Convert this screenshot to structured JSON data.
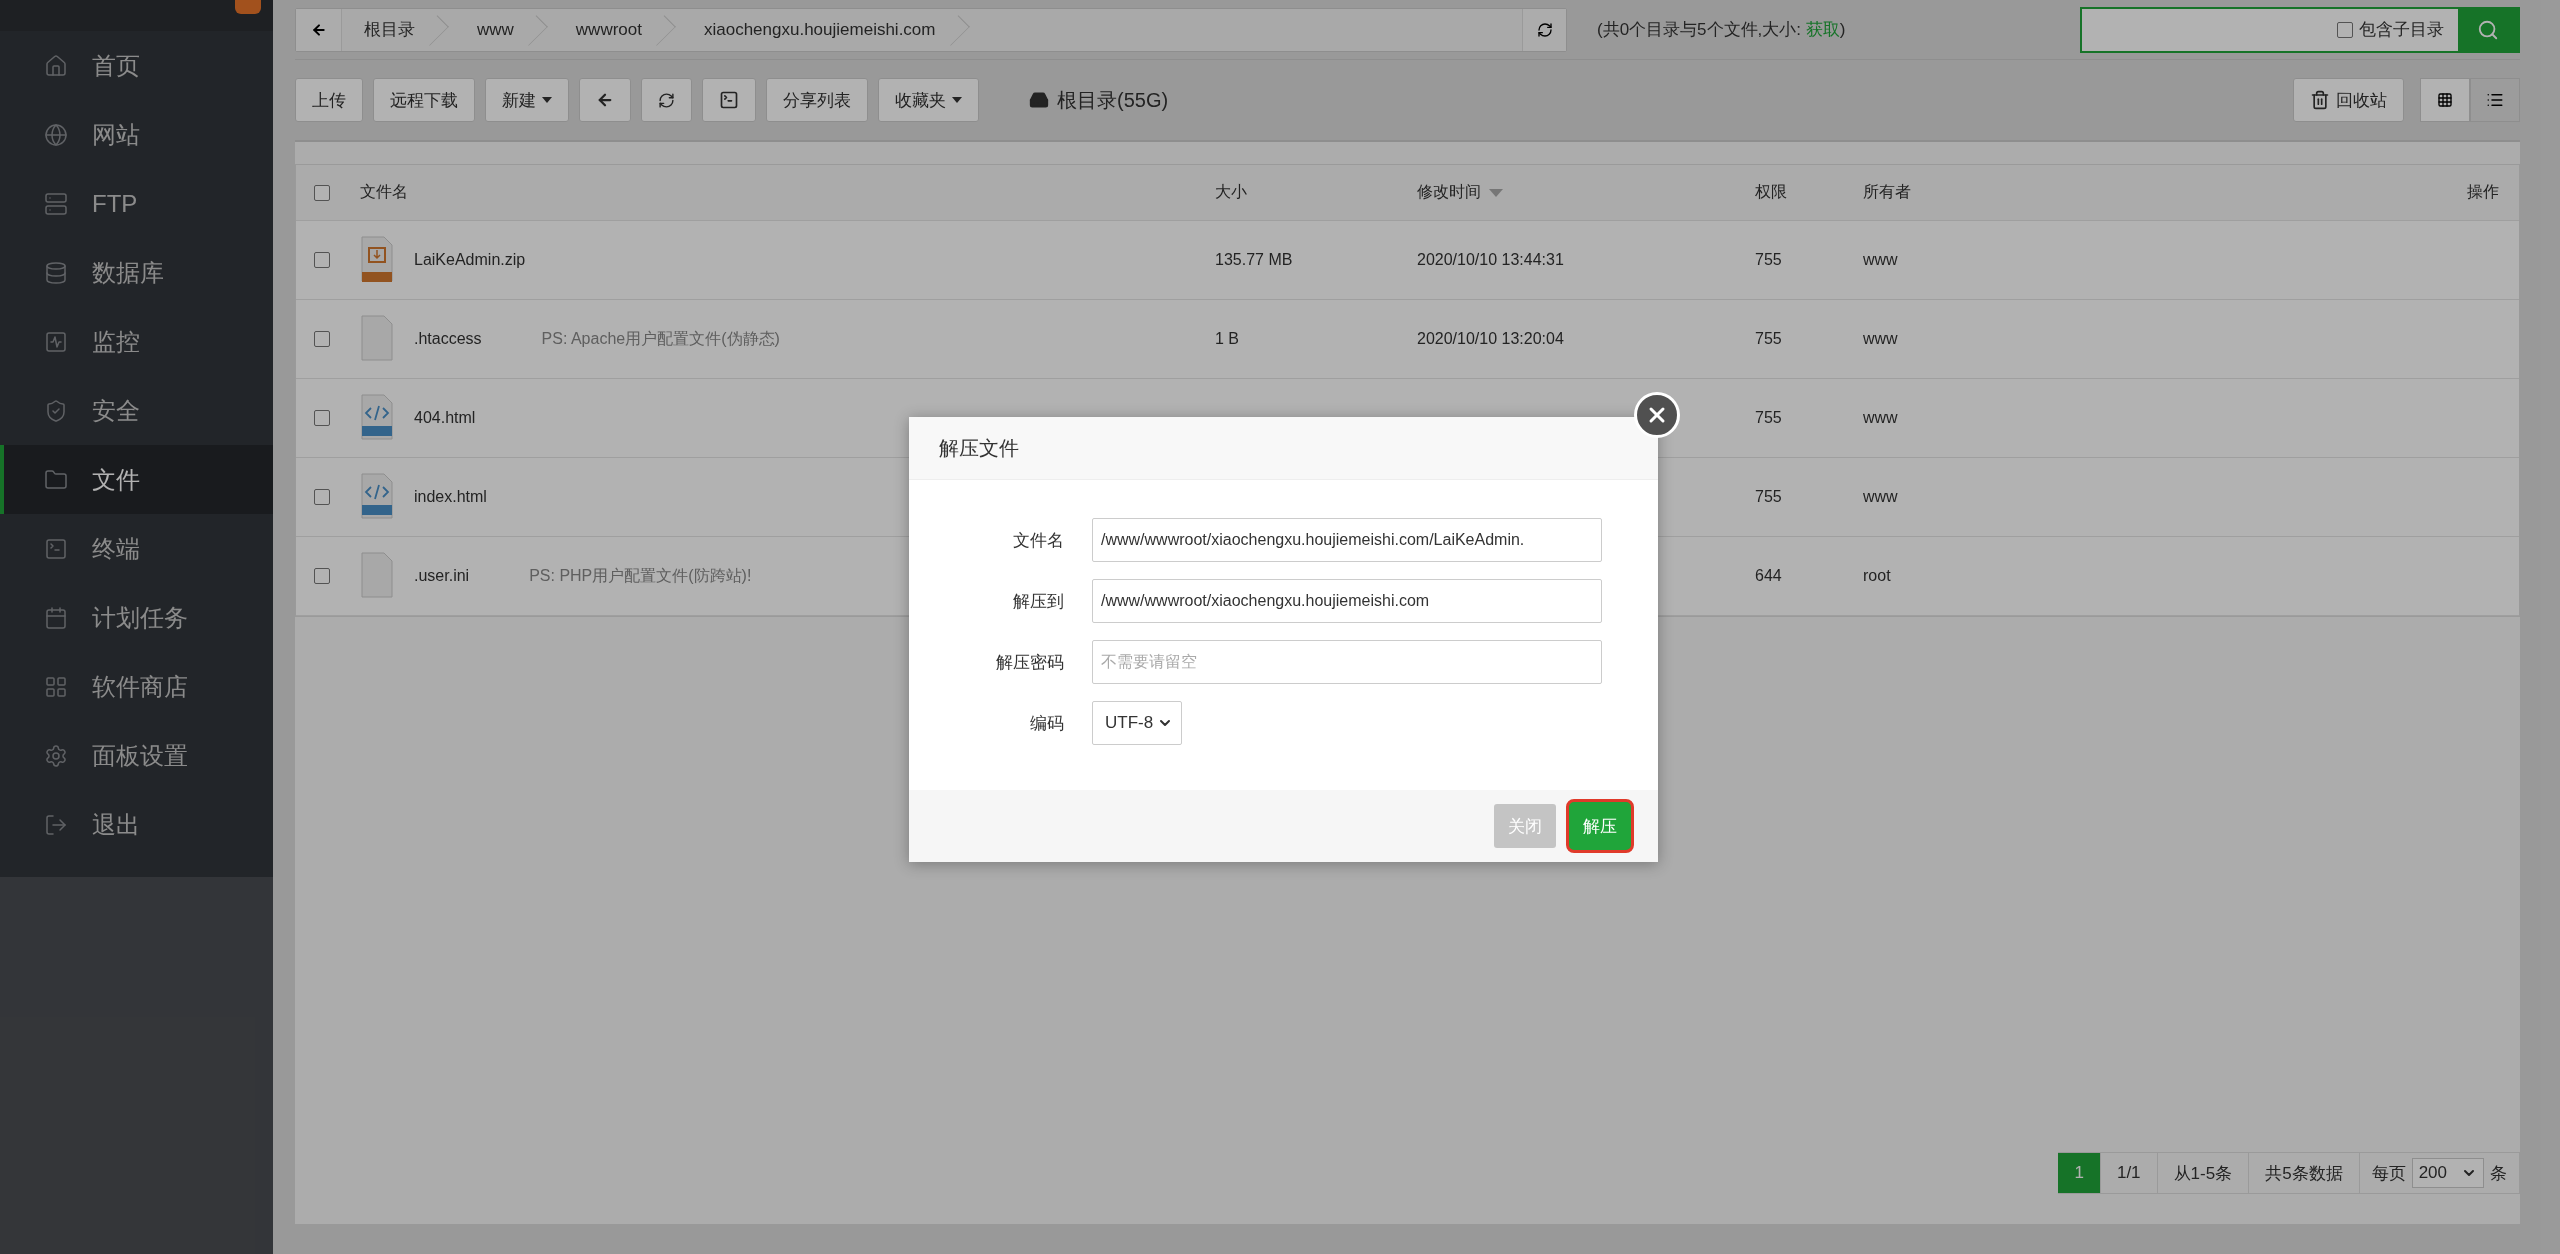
{
  "sidebar": {
    "items": [
      {
        "label": "首页",
        "selected": false
      },
      {
        "label": "网站",
        "selected": false
      },
      {
        "label": "FTP",
        "selected": false
      },
      {
        "label": "数据库",
        "selected": false
      },
      {
        "label": "监控",
        "selected": false
      },
      {
        "label": "安全",
        "selected": false
      },
      {
        "label": "文件",
        "selected": true
      },
      {
        "label": "终端",
        "selected": false
      },
      {
        "label": "计划任务",
        "selected": false
      },
      {
        "label": "软件商店",
        "selected": false
      },
      {
        "label": "面板设置",
        "selected": false
      },
      {
        "label": "退出",
        "selected": false
      }
    ]
  },
  "breadcrumb": {
    "segments": [
      "根目录",
      "www",
      "wwwroot",
      "xiaochengxu.houjiemeishi.com"
    ]
  },
  "summary": {
    "prefix": "(共0个目录与5个文件,大小: ",
    "link": "获取",
    "suffix": ")"
  },
  "search": {
    "checkbox_label": "包含子目录",
    "include_subdirs": false
  },
  "toolbar": {
    "buttons": [
      {
        "kind": "text",
        "label": "上传"
      },
      {
        "kind": "text",
        "label": "远程下载"
      },
      {
        "kind": "dropdown",
        "label": "新建"
      },
      {
        "kind": "back"
      },
      {
        "kind": "refresh"
      },
      {
        "kind": "terminal"
      },
      {
        "kind": "text",
        "label": "分享列表"
      },
      {
        "kind": "dropdown",
        "label": "收藏夹"
      }
    ],
    "disk": "根目录(55G)",
    "recycle": "回收站",
    "views": [
      {
        "selected": false
      },
      {
        "selected": true
      }
    ]
  },
  "table": {
    "all_checked": false,
    "columns": [
      {
        "label": "文件名",
        "sorted": false
      },
      {
        "label": "大小",
        "sorted": false
      },
      {
        "label": "修改时间",
        "sorted": true
      },
      {
        "label": "权限",
        "sorted": false
      },
      {
        "label": "所有者",
        "sorted": false
      },
      {
        "label": "操作",
        "sorted": false
      }
    ],
    "rows": [
      {
        "kind": "zip",
        "name": "LaiKeAdmin.zip",
        "size": "135.77 MB",
        "modified": "2020/10/10 13:44:31",
        "permissions": "755",
        "owner": "www",
        "checked": false
      },
      {
        "kind": "file",
        "name": ".htaccess",
        "note": "PS: Apache用户配置文件(伪静态)",
        "size": "1 B",
        "modified": "2020/10/10 13:20:04",
        "permissions": "755",
        "owner": "www",
        "checked": false
      },
      {
        "kind": "html",
        "name": "404.html",
        "permissions": "755",
        "owner": "www",
        "checked": false
      },
      {
        "kind": "html",
        "name": "index.html",
        "permissions": "755",
        "owner": "www",
        "checked": false
      },
      {
        "kind": "file",
        "name": ".user.ini",
        "note": "PS: PHP用户配置文件(防跨站)!",
        "permissions": "644",
        "owner": "root",
        "checked": false
      }
    ]
  },
  "pagination": {
    "current": "1",
    "pages": "1/1",
    "range": "从1-5条",
    "total": "共5条数据",
    "per_page_label": "每页",
    "per_page": "200",
    "unit": "条"
  },
  "modal": {
    "title": "解压文件",
    "fields": [
      {
        "kind": "text",
        "label": "文件名",
        "value": "/www/wwwroot/xiaochengxu.houjiemeishi.com/LaiKeAdmin."
      },
      {
        "kind": "text",
        "label": "解压到",
        "value": "/www/wwwroot/xiaochengxu.houjiemeishi.com"
      },
      {
        "kind": "text",
        "label": "解压密码",
        "placeholder": "不需要请留空"
      },
      {
        "kind": "select",
        "label": "编码",
        "value": "UTF-8"
      }
    ],
    "buttons": [
      {
        "kind": "secondary",
        "label": "关闭",
        "highlighted": false
      },
      {
        "kind": "primary",
        "label": "解压",
        "highlighted": true
      }
    ]
  }
}
